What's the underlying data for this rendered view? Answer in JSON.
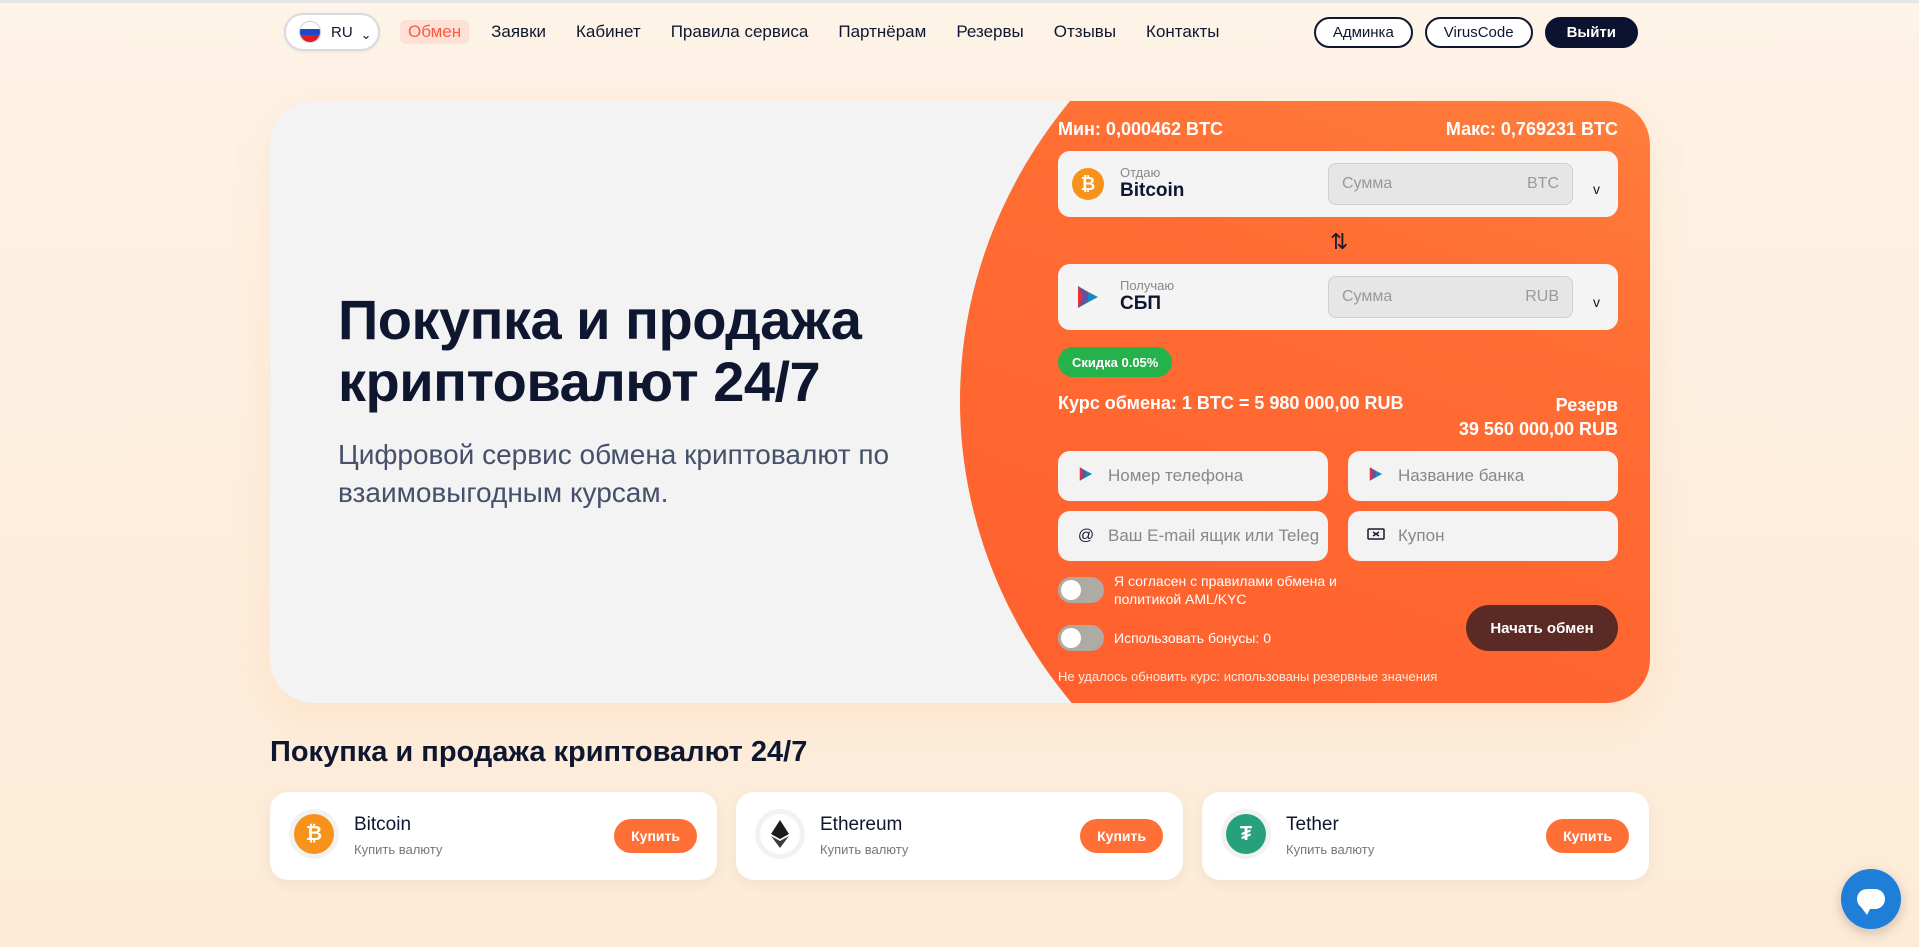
{
  "nav": {
    "lang": "RU",
    "lang_caret": "⌄",
    "menu": [
      "Обмен",
      "Заявки",
      "Кабинет",
      "Правила сервиса",
      "Партнёрам",
      "Резервы",
      "Отзывы",
      "Контакты"
    ],
    "buttons": {
      "admin": "Админка",
      "user": "VirusCode",
      "logout": "Выйти"
    }
  },
  "hero": {
    "title": "Покупка и продажа криптовалют 24/7",
    "subtitle": "Цифровой сервис обмена криптовалют по взаимовыгодным курсам."
  },
  "exchange": {
    "min": "Мин: 0,000462 BTC",
    "max": "Макс: 0,769231 BTC",
    "give": {
      "caption": "Отдаю",
      "name": "Bitcoin",
      "placeholder": "Сумма",
      "unit": "BTC",
      "icon": "bitcoin-icon"
    },
    "get": {
      "caption": "Получаю",
      "name": "СБП",
      "placeholder": "Сумма",
      "unit": "RUB",
      "icon": "sbp-icon"
    },
    "caret": "v",
    "swap": "⇅",
    "discount": "Скидка 0.05%",
    "rate": "Курс обмена: 1 BTC = 5 980 000,00 RUB",
    "reserve_label": "Резерв",
    "reserve_value": "39 560 000,00 RUB",
    "fields": {
      "phone": "Номер телефона",
      "bank": "Название банка",
      "email": "Ваш E-mail ящик или Teleg",
      "coupon": "Купон"
    },
    "agree": "Я согласен с правилами обмена и политикой AML/KYC",
    "bonus": "Использовать бонусы: 0",
    "start": "Начать обмен",
    "warning": "Не удалось обновить курс: использованы резервные значения"
  },
  "section": {
    "title": "Покупка и продажа криптовалют 24/7",
    "cards": [
      {
        "name": "Bitcoin",
        "sub": "Купить валюту",
        "button": "Купить",
        "color": "#f7931a",
        "icon": "bitcoin-icon"
      },
      {
        "name": "Ethereum",
        "sub": "Купить валюту",
        "button": "Купить",
        "color": "#ffffff",
        "icon": "ethereum-icon"
      },
      {
        "name": "Tether",
        "sub": "Купить валюту",
        "button": "Купить",
        "color": "#26a17b",
        "icon": "tether-icon"
      }
    ]
  },
  "colors": {
    "accent": "#ff6d33",
    "dark": "#0c1230",
    "green": "#26b24a"
  }
}
